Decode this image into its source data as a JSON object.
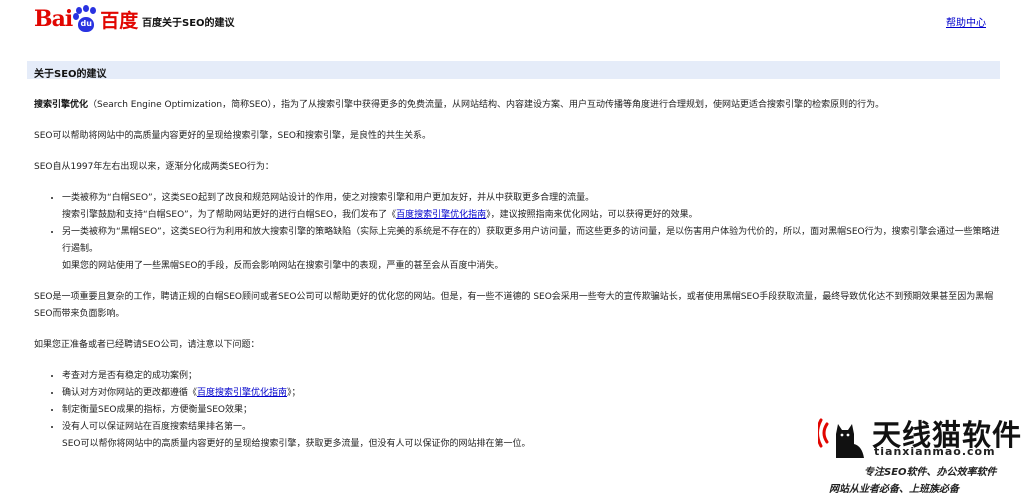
{
  "header": {
    "logo_text_left": "Bai",
    "logo_text_paw": "du",
    "logo_text_right": "百度",
    "title": "百度关于SEO的建议",
    "help_link": "帮助中心"
  },
  "section": {
    "title": "关于SEO的建议"
  },
  "intro": {
    "term": "搜索引擎优化",
    "rest": "（Search Engine Optimization，简称SEO），指为了从搜索引擎中获得更多的免费流量，从网站结构、内容建设方案、用户互动传播等角度进行合理规划，使网站更适合搜索引擎的检索原则的行为。"
  },
  "para2": "SEO可以帮助将网站中的高质量内容更好的呈现给搜索引擎，SEO和搜索引擎，是良性的共生关系。",
  "para3": "SEO自从1997年左右出现以来，逐渐分化成两类SEO行为：",
  "types": [
    {
      "line1": "一类被称为“白帽SEO”，这类SEO起到了改良和规范网站设计的作用，使之对搜索引擎和用户更加友好，并从中获取更多合理的流量。",
      "line2_pre": "搜索引擎鼓励和支持“白帽SEO”，为了帮助网站更好的进行白帽SEO，我们发布了《",
      "line2_link": "百度搜索引擎优化指南",
      "line2_post": "》，建议按照指南来优化网站，可以获得更好的效果。"
    },
    {
      "line1": "另一类被称为“黑帽SEO”，这类SEO行为利用和放大搜索引擎的策略缺陷（实际上完美的系统是不存在的）获取更多用户访问量，而这些更多的访问量，是以伤害用户体验为代价的，所以，面对黑帽SEO行为，搜索引擎会通过一些策略进行遏制。",
      "line2": "如果您的网站使用了一些黑帽SEO的手段，反而会影响网站在搜索引擎中的表现，严重的甚至会从百度中消失。"
    }
  ],
  "para4": "SEO是一项重要且复杂的工作，聘请正规的白帽SEO顾问或者SEO公司可以帮助更好的优化您的网站。但是，有一些不道德的 SEO会采用一些夸大的宣传欺骗站长，或者使用黑帽SEO手段获取流量，最终导致优化达不到预期效果甚至因为黑帽SEO而带来负面影响。",
  "para5": "如果您正准备或者已经聘请SEO公司，请注意以下问题：",
  "tips": {
    "t1": "考查对方是否有稳定的成功案例；",
    "t2_pre": "确认对方对你网站的更改都遵循《",
    "t2_link": "百度搜索引擎优化指南",
    "t2_post": "》；",
    "t3": "制定衡量SEO成果的指标，方便衡量SEO效果；",
    "t4_line1": "没有人可以保证网站在百度搜索结果排名第一。",
    "t4_line2": "SEO可以帮你将网站中的高质量内容更好的呈现给搜索引擎，获取更多流量，但没有人可以保证你的网站排在第一位。"
  },
  "watermark": {
    "title": "天线猫软件",
    "url": "tianxianmao.com",
    "tagline1": "专注SEO软件、办公效率软件",
    "tagline2": "网站从业者必备、上班族必备"
  },
  "colors": {
    "baidu_red": "#e10601",
    "baidu_blue": "#2932e1",
    "section_bg": "#e5ecf9",
    "link": "#0000cc"
  }
}
